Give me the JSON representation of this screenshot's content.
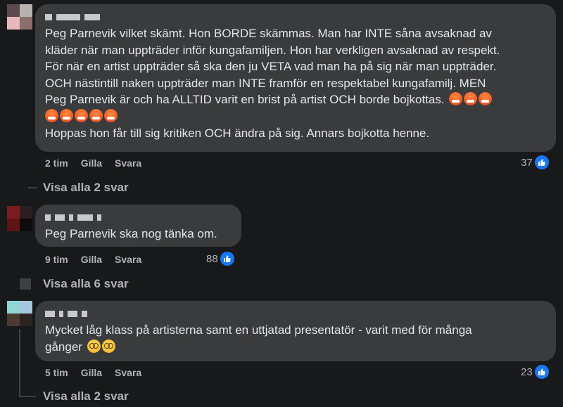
{
  "comments": [
    {
      "text_lines": [
        "Peg Parnevik vilket skämt. Hon BORDE skämmas. Man har INTE såna avsaknad av",
        "kläder när man uppträder inför kungafamiljen. Hon har verkligen avsaknad av respekt.",
        "För när en artist uppträder så ska den ju VETA vad man ha på sig när man uppträder.",
        "OCH nästintill naken uppträder man INTE framför en respektabel kungafamilj. MEN",
        "Peg Parnevik är och ha ALLTID varit en brist på artist OCH borde bojkottas.",
        "",
        "Hoppas hon får till sig kritiken OCH ändra på sig. Annars bojkotta henne."
      ],
      "time": "2 tim",
      "like_label": "Gilla",
      "reply_label": "Svara",
      "likes": "37",
      "view_replies": "Visa alla 2 svar"
    },
    {
      "text_lines": [
        "Peg Parnevik ska nog tänka om."
      ],
      "time": "9 tim",
      "like_label": "Gilla",
      "reply_label": "Svara",
      "likes": "88",
      "view_replies": "Visa alla 6 svar"
    },
    {
      "text_lines": [
        "Mycket låg klass på artisterna samt en uttjatad presentatör - varit med för många",
        "gånger"
      ],
      "time": "5 tim",
      "like_label": "Gilla",
      "reply_label": "Svara",
      "likes": "23",
      "view_replies": "Visa alla 2 svar"
    }
  ],
  "icons": {
    "like": "thumbs-up-icon",
    "angry_emoji": "angry-face-emoji",
    "dizzy_emoji": "dizzy-face-emoji"
  },
  "colors": {
    "background": "#18191a",
    "bubble": "#3a3b3c",
    "text": "#e4e6eb",
    "secondary_text": "#b0b3b8",
    "like_blue": "#1877f2"
  }
}
